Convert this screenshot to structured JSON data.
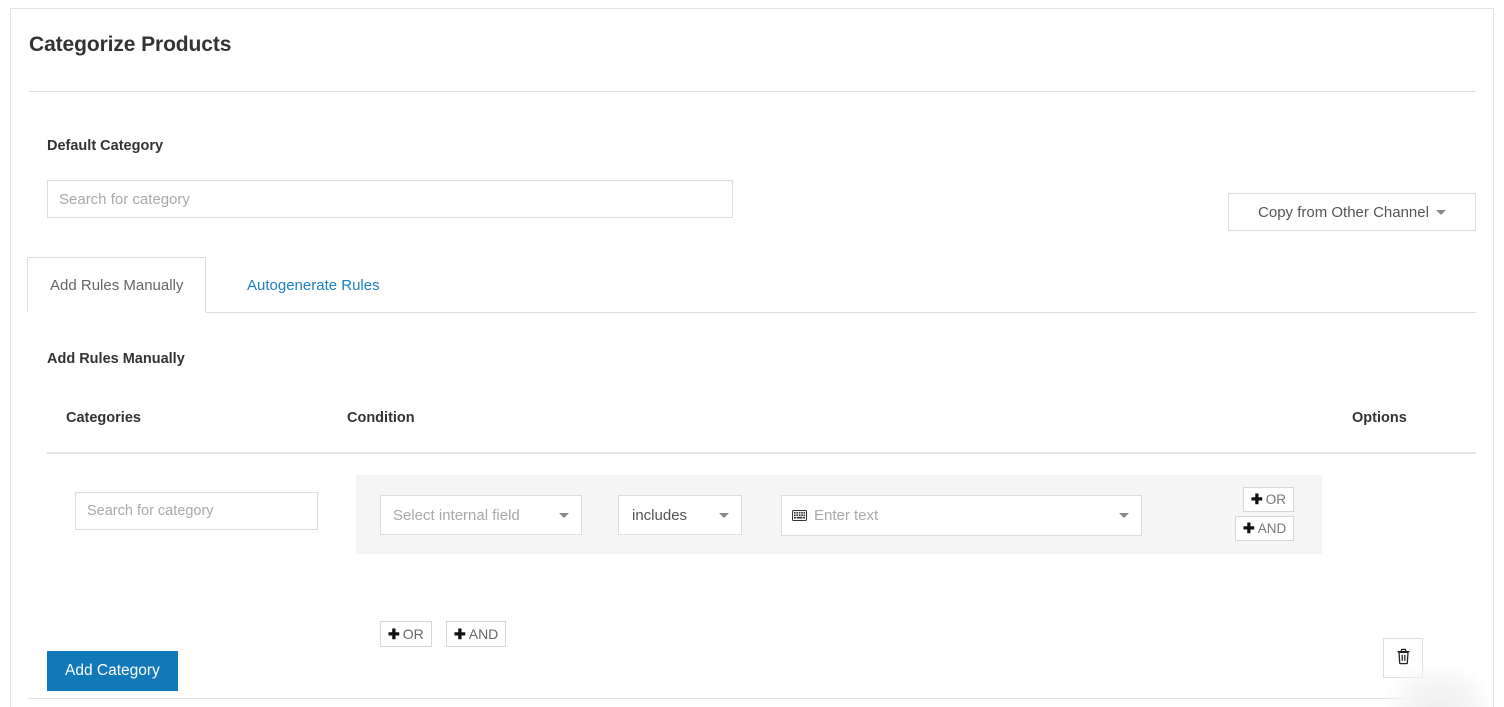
{
  "panel": {
    "title": "Categorize Products"
  },
  "default_category": {
    "label": "Default Category",
    "placeholder": "Search for category",
    "value": ""
  },
  "copy_channel": {
    "label": "Copy from Other Channel",
    "icon": "chevron-down-icon"
  },
  "tabs": [
    {
      "label": "Add Rules Manually",
      "active": true
    },
    {
      "label": "Autogenerate Rules",
      "active": false
    }
  ],
  "section": {
    "heading": "Add Rules Manually"
  },
  "table": {
    "headers": {
      "categories": "Categories",
      "condition": "Condition",
      "options": "Options"
    },
    "rows": [
      {
        "category": {
          "placeholder": "Search for category",
          "value": ""
        },
        "condition": {
          "field_select": {
            "value": "Select internal field",
            "icon": "chevron-down-icon"
          },
          "operator_select": {
            "value": "includes",
            "icon": "chevron-down-icon"
          },
          "text_entry": {
            "icon": "keyboard-icon",
            "placeholder": "Enter text",
            "value": "",
            "dropdown_icon": "chevron-down-icon"
          },
          "inline_buttons": [
            {
              "plus": "✚",
              "label": "OR"
            },
            {
              "plus": "✚",
              "label": "AND"
            }
          ]
        },
        "below_buttons": [
          {
            "plus": "✚",
            "label": "OR"
          },
          {
            "plus": "✚",
            "label": "AND"
          }
        ],
        "options": {
          "delete_icon": "trash-icon"
        }
      }
    ]
  },
  "actions": {
    "add_category": "Add Category"
  },
  "colors": {
    "accent_blue": "#1279b8",
    "link_blue": "#1b7fc3",
    "row_background": "#f5f5f5",
    "border": "#dddddd",
    "text": "#333333",
    "placeholder": "#a9a9a9"
  }
}
